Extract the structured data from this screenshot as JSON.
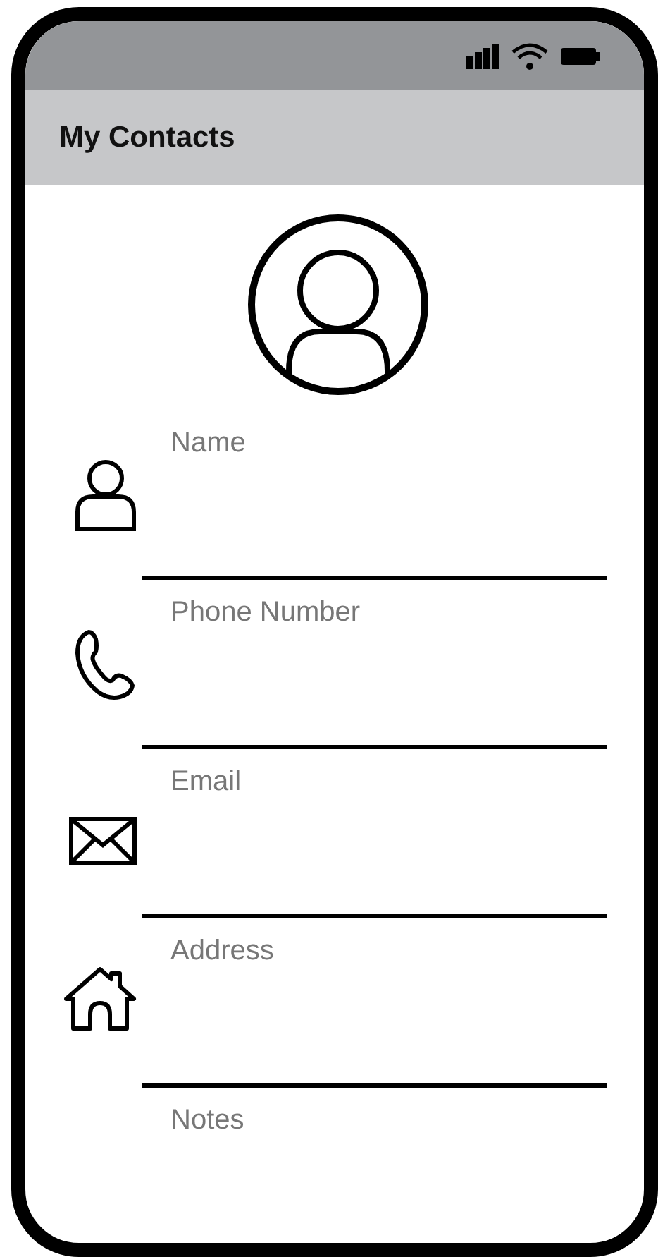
{
  "header": {
    "title": "My Contacts"
  },
  "fields": [
    {
      "label": "Name",
      "kind": "person"
    },
    {
      "label": "Phone Number",
      "kind": "phone"
    },
    {
      "label": "Email",
      "kind": "email"
    },
    {
      "label": "Address",
      "kind": "home"
    },
    {
      "label": "Notes",
      "kind": "notes"
    }
  ]
}
